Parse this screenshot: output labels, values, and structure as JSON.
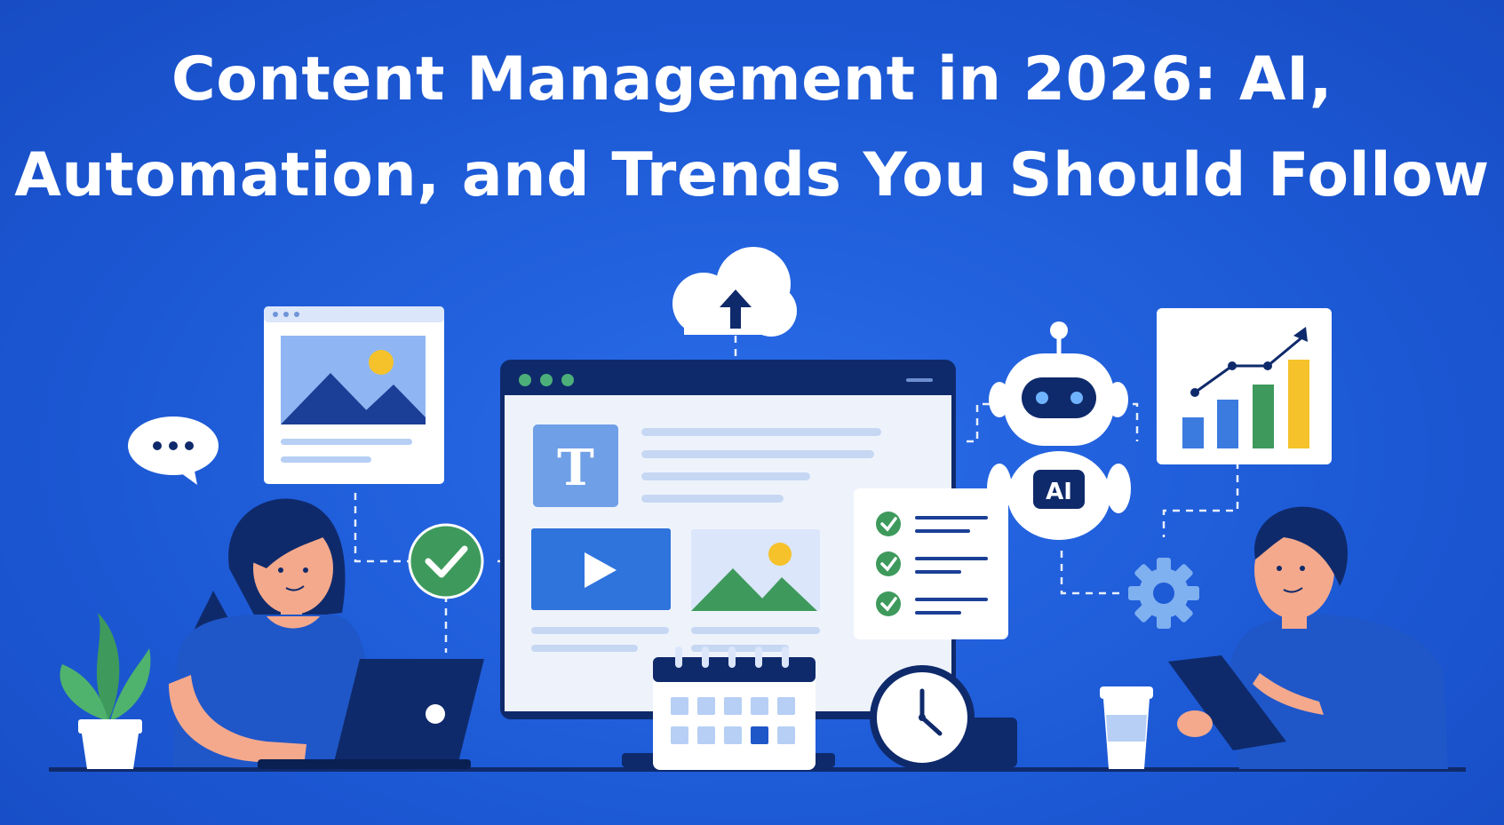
{
  "header": {
    "title_line_1": "Content Management in 2026: AI,",
    "title_line_2": "Automation, and Trends You Should Follow"
  },
  "illustration": {
    "editor_text_block_letter": "T",
    "robot_badge_label": "AI",
    "icons": [
      "chat-bubble-icon",
      "image-card-icon",
      "cloud-upload-icon",
      "browser-editor-icon",
      "play-icon",
      "check-circle-icon",
      "checklist-icon",
      "robot-icon",
      "bar-chart-icon",
      "gear-icon",
      "calendar-icon",
      "clock-icon",
      "laptop-icon",
      "tablet-icon",
      "coffee-cup-icon",
      "plant-icon"
    ]
  },
  "colors": {
    "background": "#1f5fd6",
    "navy": "#0f2a6b",
    "light_blue": "#9cc0f5",
    "green": "#3e9a5c",
    "yellow": "#f5c22b",
    "skin": "#f4a98c",
    "white": "#ffffff"
  }
}
